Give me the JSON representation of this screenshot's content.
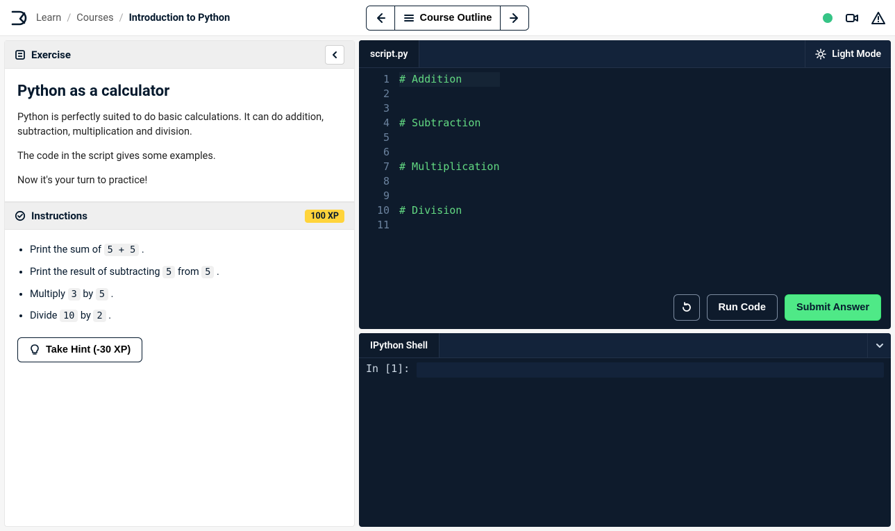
{
  "header": {
    "breadcrumbs": [
      "Learn",
      "Courses",
      "Introduction to Python"
    ],
    "course_outline_label": "Course Outline"
  },
  "exercise": {
    "section_label": "Exercise",
    "title": "Python as a calculator",
    "paragraphs": [
      "Python is perfectly suited to do basic calculations. It can do addition, subtraction, multiplication and division.",
      "The code in the script gives some examples.",
      "Now it's your turn to practice!"
    ]
  },
  "instructions": {
    "section_label": "Instructions",
    "xp_badge": "100 XP",
    "items": [
      {
        "pre": "Print the sum of ",
        "codes": [
          "5 + 5"
        ],
        "mids": [],
        "post": " ."
      },
      {
        "pre": "Print the result of subtracting ",
        "codes": [
          "5",
          "5"
        ],
        "mids": [
          " from "
        ],
        "post": " ."
      },
      {
        "pre": "Multiply ",
        "codes": [
          "3",
          "5"
        ],
        "mids": [
          " by "
        ],
        "post": " ."
      },
      {
        "pre": "Divide ",
        "codes": [
          "10",
          "2"
        ],
        "mids": [
          " by "
        ],
        "post": " ."
      }
    ],
    "hint_label": "Take Hint (-30 XP)"
  },
  "editor": {
    "filename": "script.py",
    "light_mode_label": "Light Mode",
    "code_lines": [
      "# Addition",
      "",
      "",
      "# Subtraction",
      "",
      "",
      "# Multiplication",
      "",
      "",
      "# Division",
      ""
    ],
    "run_label": "Run Code",
    "submit_label": "Submit Answer"
  },
  "shell": {
    "tab_label": "IPython Shell",
    "prompt": "In [1]:"
  }
}
